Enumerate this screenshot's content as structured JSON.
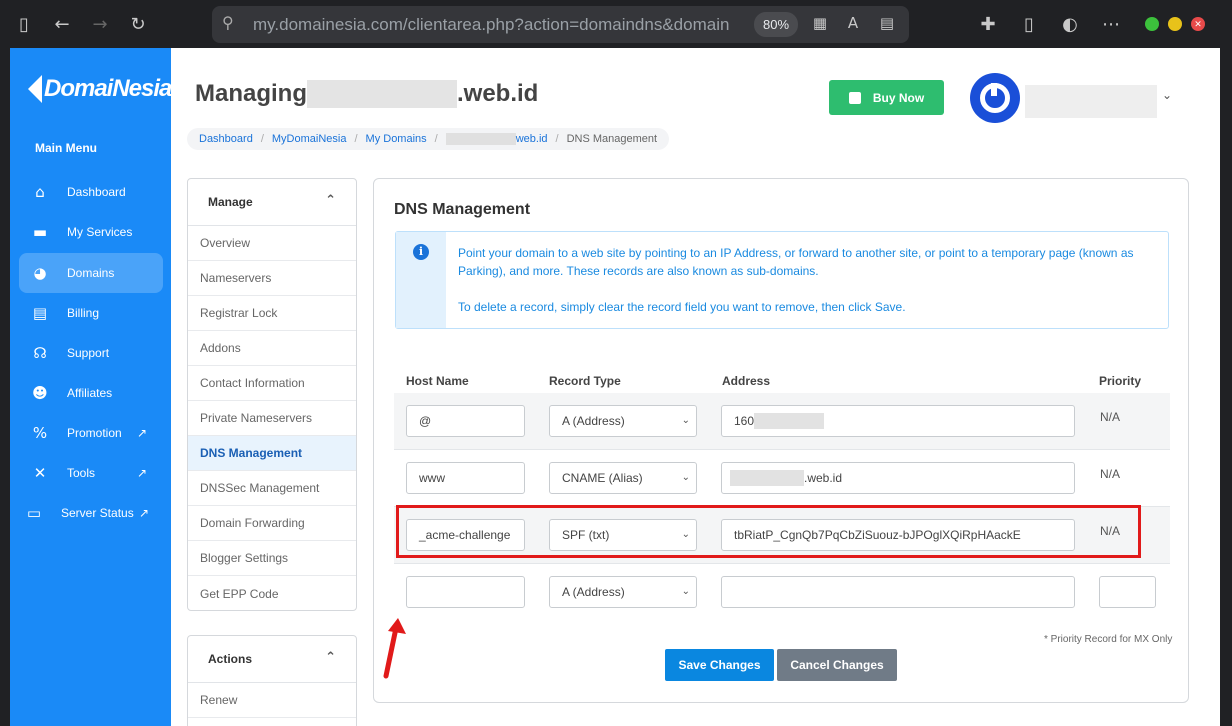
{
  "browser": {
    "url": "my.domainesia.com/clientarea.php?action=domaindns&domain",
    "zoom": "80%"
  },
  "sidebar": {
    "brand": "DomaiNesia",
    "main_menu": "Main Menu",
    "items": [
      {
        "label": "Dashboard"
      },
      {
        "label": "My Services"
      },
      {
        "label": "Domains"
      },
      {
        "label": "Billing"
      },
      {
        "label": "Support"
      },
      {
        "label": "Affiliates"
      },
      {
        "label": "Promotion"
      },
      {
        "label": "Tools"
      },
      {
        "label": "Server Status"
      }
    ]
  },
  "header": {
    "title_prefix": "Managing",
    "title_suffix": ".web.id",
    "buy_now": "Buy Now"
  },
  "breadcrumb": {
    "dashboard": "Dashboard",
    "mydomainesia": "MyDomaiNesia",
    "mydomains": "My Domains",
    "domain_suffix": "web.id",
    "current": "DNS Management"
  },
  "manage_panel": {
    "title": "Manage",
    "items": [
      {
        "label": "Overview"
      },
      {
        "label": "Nameservers"
      },
      {
        "label": "Registrar Lock"
      },
      {
        "label": "Addons"
      },
      {
        "label": "Contact Information"
      },
      {
        "label": "Private Nameservers"
      },
      {
        "label": "DNS Management"
      },
      {
        "label": "DNSSec Management"
      },
      {
        "label": "Domain Forwarding"
      },
      {
        "label": "Blogger Settings"
      },
      {
        "label": "Get EPP Code"
      }
    ]
  },
  "actions_panel": {
    "title": "Actions",
    "items": [
      {
        "label": "Renew"
      }
    ]
  },
  "dns": {
    "title": "DNS Management",
    "info_line1": "Point your domain to a web site by pointing to an IP Address, or forward to another site, or point to a temporary page (known as",
    "info_line2": "Parking), and more. These records are also known as sub-domains.",
    "info_line3": "To delete a record, simply clear the record field you want to remove, then click Save.",
    "columns": {
      "host": "Host Name",
      "type": "Record Type",
      "address": "Address",
      "priority": "Priority"
    },
    "rows": [
      {
        "host": "@",
        "type": "A (Address)",
        "address": "160",
        "priority": "N/A"
      },
      {
        "host": "www",
        "type": "CNAME (Alias)",
        "address": ".web.id",
        "priority": "N/A"
      },
      {
        "host": "_acme-challenge",
        "type": "SPF (txt)",
        "address": "tbRiatP_CgnQb7PqCbZiSuouz-bJPOglXQiRpHAackE",
        "priority": "N/A"
      },
      {
        "host": "",
        "type": "A (Address)",
        "address": "",
        "priority": ""
      }
    ],
    "footnote": "* Priority Record for MX Only",
    "save": "Save Changes",
    "cancel": "Cancel Changes"
  },
  "colors": {
    "sidebar": "#1a8af7",
    "buy": "#2ebd6f",
    "save": "#0a87e0",
    "cancel": "#707b87",
    "highlight": "#e11a1a"
  }
}
